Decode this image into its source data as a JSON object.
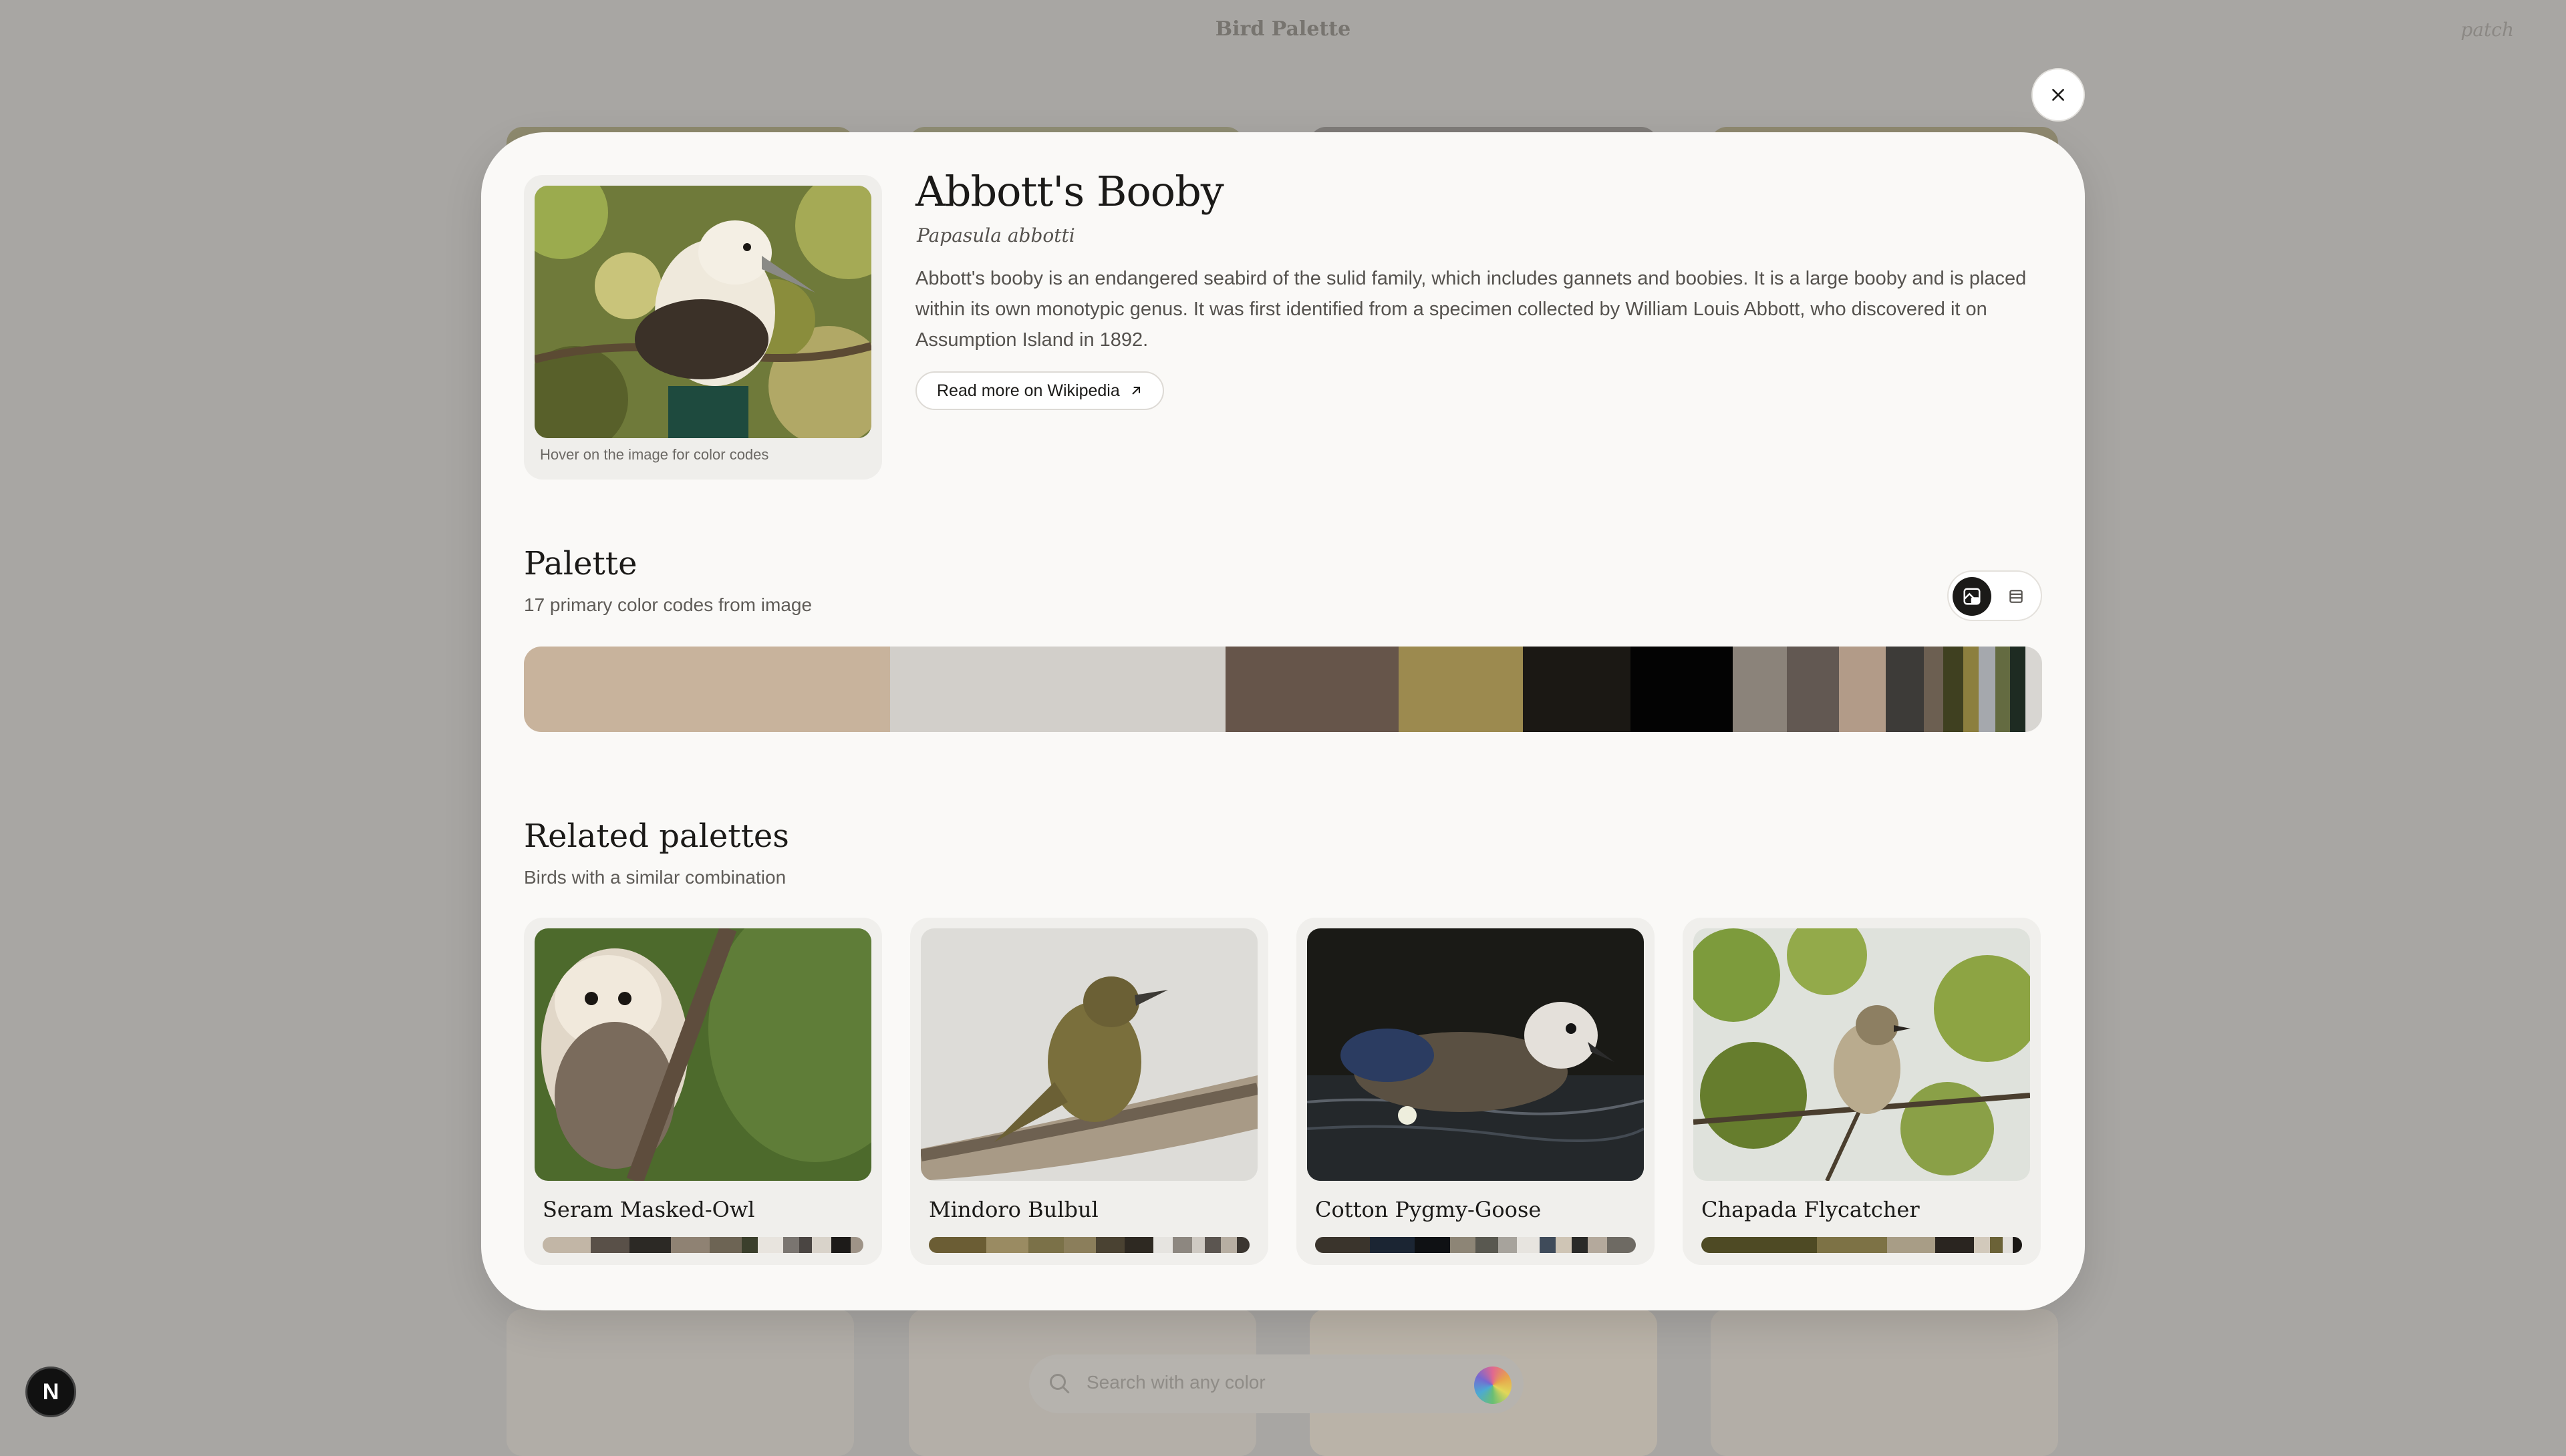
{
  "background": {
    "app_title": "Bird Palette",
    "header_link": "patch",
    "search_placeholder": "Search with any color",
    "badge_letter": "N"
  },
  "modal": {
    "bird": {
      "name": "Abbott's Booby",
      "scientific_name": "Papasula abbotti",
      "description": "Abbott's booby is an endangered seabird of the sulid family, which includes gannets and boobies. It is a large booby and is placed within its own monotypic genus. It was first identified from a specimen collected by William Louis Abbott, who discovered it on Assumption Island in 1892.",
      "wiki_label": "Read more on Wikipedia",
      "hover_caption": "Hover on the image for color codes"
    },
    "palette": {
      "title": "Palette",
      "subtitle": "17 primary color codes from image",
      "view_toggle": [
        "image-view-icon",
        "list-view-icon"
      ],
      "swatches": [
        {
          "color": "#c8b39c",
          "share": 0.241
        },
        {
          "color": "#d2cfca",
          "share": 0.221
        },
        {
          "color": "#66554a",
          "share": 0.114
        },
        {
          "color": "#9c8a4f",
          "share": 0.082
        },
        {
          "color": "#1b1814",
          "share": 0.071
        },
        {
          "color": "#030303",
          "share": 0.067
        },
        {
          "color": "#8b837a",
          "share": 0.036
        },
        {
          "color": "#625852",
          "share": 0.034
        },
        {
          "color": "#b29b88",
          "share": 0.031
        },
        {
          "color": "#3d3b38",
          "share": 0.025
        },
        {
          "color": "#6c5f51",
          "share": 0.013
        },
        {
          "color": "#3f4020",
          "share": 0.013
        },
        {
          "color": "#8c7f3e",
          "share": 0.01
        },
        {
          "color": "#a5a8ad",
          "share": 0.011
        },
        {
          "color": "#646b41",
          "share": 0.01
        },
        {
          "color": "#1e2b22",
          "share": 0.01
        },
        {
          "color": "#d8d6d2",
          "share": 0.011
        }
      ]
    },
    "related": {
      "title": "Related palettes",
      "subtitle": "Birds with a similar combination",
      "cards": [
        {
          "name": "Seram Masked-Owl",
          "palette": [
            {
              "color": "#c2b6a6",
              "share": 0.15
            },
            {
              "color": "#595048",
              "share": 0.12
            },
            {
              "color": "#2c2925",
              "share": 0.13
            },
            {
              "color": "#8f8273",
              "share": 0.12
            },
            {
              "color": "#6d6454",
              "share": 0.1
            },
            {
              "color": "#3b3f2c",
              "share": 0.05
            },
            {
              "color": "#e8e4de",
              "share": 0.08
            },
            {
              "color": "#7a7570",
              "share": 0.05
            },
            {
              "color": "#4a4542",
              "share": 0.04
            },
            {
              "color": "#d9d3ca",
              "share": 0.06
            },
            {
              "color": "#1d1b19",
              "share": 0.06
            },
            {
              "color": "#9e9387",
              "share": 0.04
            }
          ]
        },
        {
          "name": "Mindoro Bulbul",
          "palette": [
            {
              "color": "#6b5d34",
              "share": 0.18
            },
            {
              "color": "#9a8b62",
              "share": 0.13
            },
            {
              "color": "#7b7148",
              "share": 0.11
            },
            {
              "color": "#8b7e5b",
              "share": 0.1
            },
            {
              "color": "#4a4232",
              "share": 0.09
            },
            {
              "color": "#2e2922",
              "share": 0.09
            },
            {
              "color": "#e6e4e0",
              "share": 0.06
            },
            {
              "color": "#8d8780",
              "share": 0.06
            },
            {
              "color": "#cfcac3",
              "share": 0.04
            },
            {
              "color": "#5b5550",
              "share": 0.05
            },
            {
              "color": "#b7aea2",
              "share": 0.05
            },
            {
              "color": "#3b3631",
              "share": 0.04
            }
          ]
        },
        {
          "name": "Cotton Pygmy-Goose",
          "palette": [
            {
              "color": "#3a342c",
              "share": 0.17
            },
            {
              "color": "#1b2533",
              "share": 0.14
            },
            {
              "color": "#0f1114",
              "share": 0.11
            },
            {
              "color": "#8d8576",
              "share": 0.08
            },
            {
              "color": "#595850",
              "share": 0.07
            },
            {
              "color": "#a7a39c",
              "share": 0.06
            },
            {
              "color": "#e7e4df",
              "share": 0.07
            },
            {
              "color": "#3f4b5a",
              "share": 0.05
            },
            {
              "color": "#cfc5b5",
              "share": 0.05
            },
            {
              "color": "#2a2a28",
              "share": 0.05
            },
            {
              "color": "#b4a99c",
              "share": 0.06
            },
            {
              "color": "#6e6a63",
              "share": 0.09
            }
          ]
        },
        {
          "name": "Chapada Flycatcher",
          "palette": [
            {
              "color": "#4e4a24",
              "share": 0.36
            },
            {
              "color": "#7d7245",
              "share": 0.22
            },
            {
              "color": "#a89d86",
              "share": 0.15
            },
            {
              "color": "#2a2520",
              "share": 0.12
            },
            {
              "color": "#d2c9bb",
              "share": 0.05
            },
            {
              "color": "#6b6237",
              "share": 0.04
            },
            {
              "color": "#e2dfda",
              "share": 0.03
            },
            {
              "color": "#1a1714",
              "share": 0.03
            }
          ]
        }
      ]
    }
  }
}
